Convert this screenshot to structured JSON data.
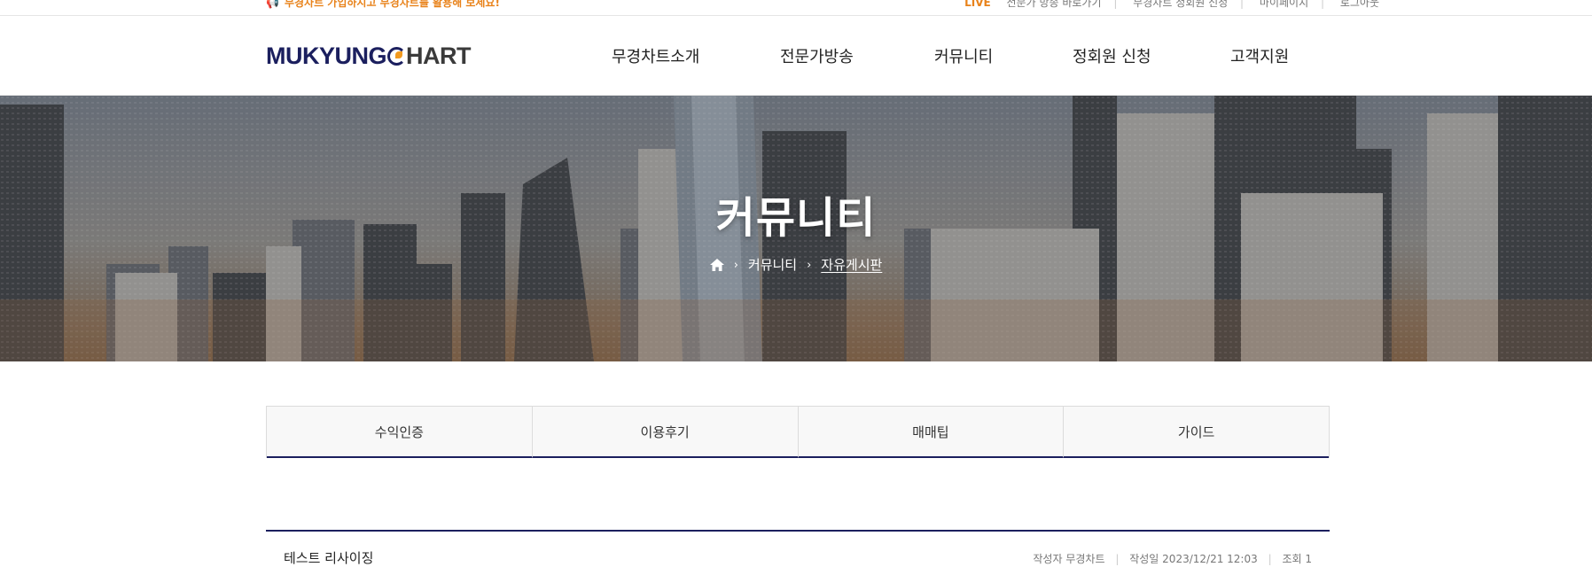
{
  "topbar": {
    "notice": "무경차트 가입하시고 무경차트를 활용해 보세요!",
    "links": [
      "LIVE",
      "전문가 방송 바로가기",
      "무경차트 정회원 신청",
      "마이페이지",
      "로그아웃"
    ]
  },
  "logo": {
    "part1": "MUKYUNG",
    "part2": "HART"
  },
  "nav": [
    "무경차트소개",
    "전문가방송",
    "커뮤니티",
    "정회원 신청",
    "고객지원"
  ],
  "hero": {
    "title": "커뮤니티",
    "breadcrumb": {
      "sep": "›",
      "section": "커뮤니티",
      "current": "자유게시판"
    }
  },
  "tabs": [
    "수익인증",
    "이용후기",
    "매매팁",
    "가이드"
  ],
  "post": {
    "title": "테스트 리사이징",
    "author_label": "작성자",
    "author": "무경차트",
    "date_label": "작성일",
    "date": "2023/12/21 12:03",
    "views_label": "조회",
    "views": "1"
  },
  "colors": {
    "brand_navy": "#1b1f5e",
    "brand_orange": "#f29a1f",
    "notice_orange": "#e8821a"
  }
}
